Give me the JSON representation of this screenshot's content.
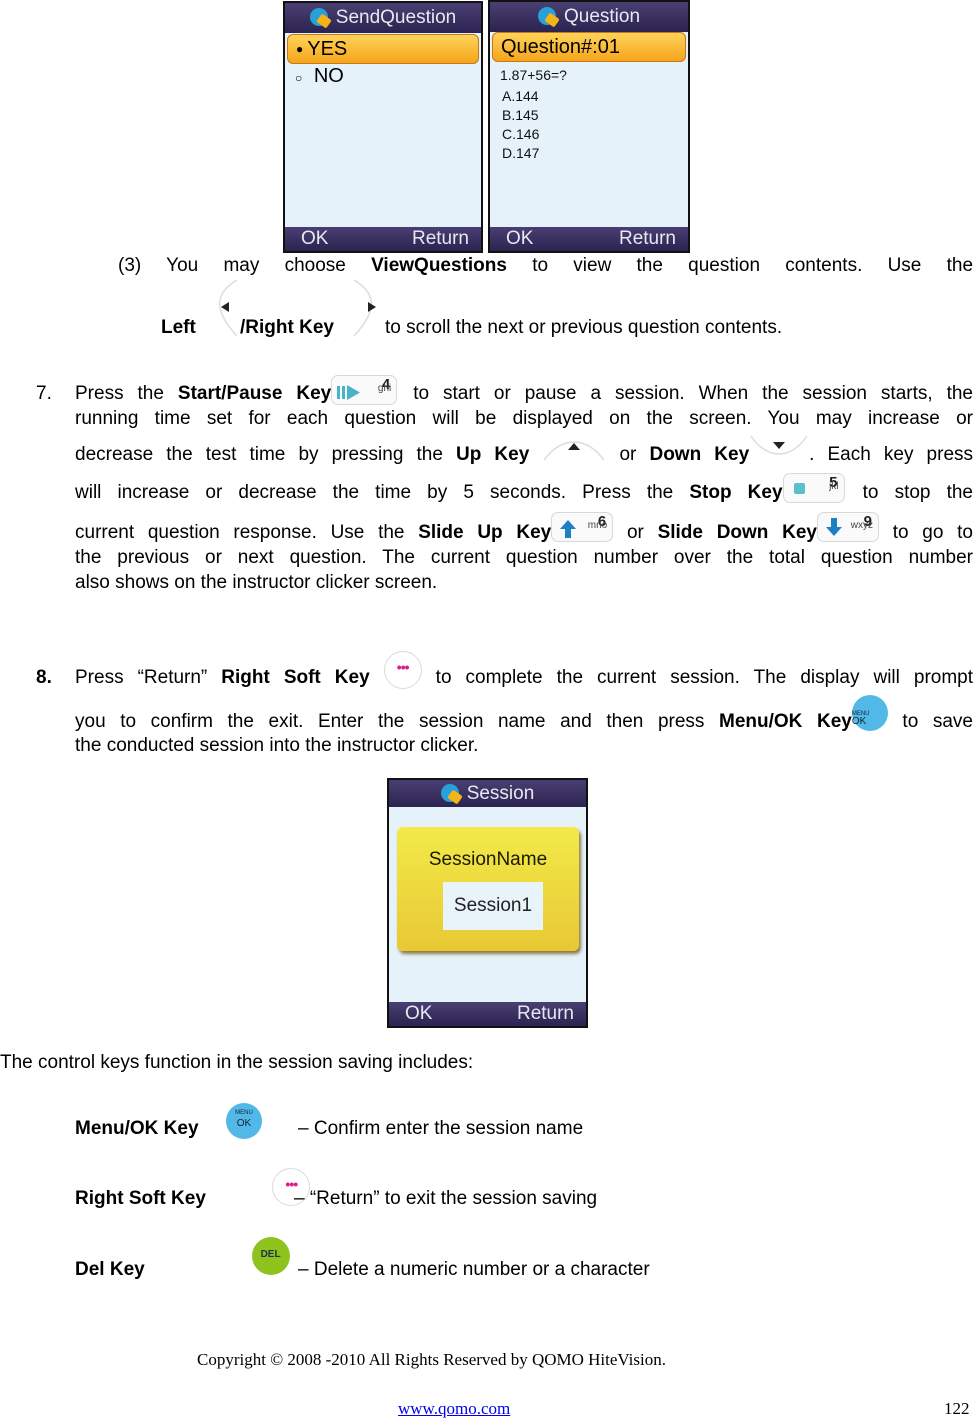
{
  "screens": {
    "send_question": {
      "title": "SendQuestion",
      "options": [
        {
          "bullet": "●",
          "label": "YES",
          "selected": true
        },
        {
          "bullet": "○",
          "label": "NO",
          "selected": false
        }
      ],
      "left_soft": "OK",
      "right_soft": "Return"
    },
    "question": {
      "title": "Question",
      "header": "Question#:01",
      "question": "1.87+56=?",
      "answers": [
        "A.144",
        "B.145",
        "C.146",
        "D.147"
      ],
      "left_soft": "OK",
      "right_soft": "Return"
    },
    "session": {
      "title": "Session",
      "label": "SessionName",
      "value": "Session1",
      "left_soft": "OK",
      "right_soft": "Return"
    }
  },
  "step3": {
    "num": "(3)",
    "t1": "You may choose",
    "b1": "ViewQuestions",
    "t2": "to view the question contents. Use the",
    "b2": "Left",
    "b3": "/Right Key",
    "t3": "to scroll the next or previous question contents."
  },
  "step7": {
    "num": "7.",
    "l1_t1": "Press the",
    "l1_b1": "Start/Pause Key",
    "l1_t2": "to start or pause a session. When the session starts, the",
    "l2": "running time set for each question will be displayed on the screen. You may increase or",
    "l3_t1": "decrease the test time by pressing the",
    "l3_b1": "Up Key",
    "l3_t2": "or",
    "l3_b2": "Down Key",
    "l3_t3": ". Each key press",
    "l4_t1": "will increase or decrease the time by 5 seconds. Press the",
    "l4_b1": "Stop Key",
    "l4_t2": "to stop the",
    "l5_t1": "current question response. Use the",
    "l5_b1": "Slide Up Key",
    "l5_t2": "or",
    "l5_b2": "Slide Down Key",
    "l5_t3": "to go to",
    "l6": "the previous or next question. The current question number over the total question number",
    "l7": "also shows on the instructor clicker screen."
  },
  "step8": {
    "num": "8.",
    "l1_t1": "Press “Return”",
    "l1_b1": "Right Soft Key",
    "l1_t2": "to complete the current session. The display will prompt",
    "l2_t1": "you to confirm the exit. Enter the session name and then press",
    "l2_b1": "Menu/OK Key",
    "l2_t2": "to save",
    "l3": "the conducted session into the instructor clicker."
  },
  "keys": {
    "start_pause": {
      "num": "4",
      "sub": "ghi"
    },
    "stop": {
      "num": "5",
      "sub": "jkl"
    },
    "slide_up": {
      "num": "6",
      "sub": "mno"
    },
    "slide_down": {
      "num": "9",
      "sub": "wxyz"
    },
    "menu_ok": {
      "top": "MENU",
      "bottom": "OK"
    },
    "del": {
      "label": "DEL"
    },
    "soft_dots": "•••",
    "colors": {
      "menu_ok": "#52b8e8",
      "del": "#8ec31e",
      "soft_dots": "#e0198c",
      "slide_arrow": "#1e7fc4",
      "stop": "#5bbfcc"
    }
  },
  "controls": {
    "intro": "The control keys function in the session saving includes:",
    "items": [
      {
        "key": "Menu/OK Key",
        "desc": "– Confirm enter the session name"
      },
      {
        "key": "Right Soft Key",
        "desc": "– “Return” to exit the session saving"
      },
      {
        "key": "Del Key",
        "desc": "– Delete a numeric number or a character"
      }
    ]
  },
  "footer": {
    "copyright": "Copyright © 2008 -2010 All Rights Reserved by QOMO HiteVision.",
    "link": "www.qomo.com",
    "page": "122"
  }
}
